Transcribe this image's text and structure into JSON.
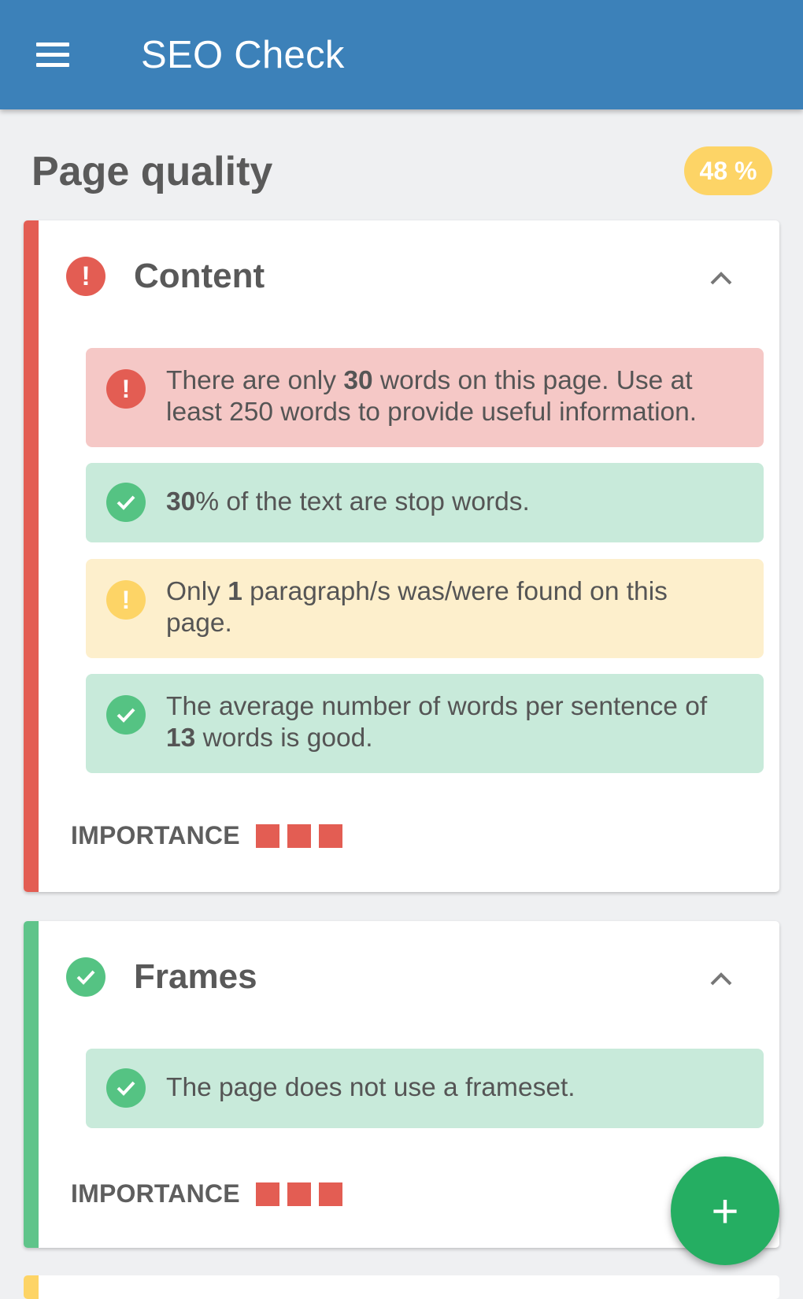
{
  "appbar": {
    "title": "SEO Check",
    "menu_icon": "hamburger-menu-icon"
  },
  "header": {
    "title": "Page quality",
    "score": "48 %"
  },
  "colors": {
    "error": "#e35d53",
    "success": "#55c383",
    "warning": "#fdd466",
    "primary": "#3c81b9",
    "fab": "#25ae62"
  },
  "cards": [
    {
      "title": "Content",
      "status": "error",
      "items": [
        {
          "status": "error",
          "pre": "There are only ",
          "bold": "30",
          "post": " words on this page. Use at least 250 words to provide useful information."
        },
        {
          "status": "success",
          "pre": "",
          "bold": "30",
          "post": "% of the text are stop words."
        },
        {
          "status": "warning",
          "pre": "Only ",
          "bold": "1",
          "post": " paragraph/s was/were found on this page."
        },
        {
          "status": "success",
          "pre": "The average number of words per sentence of ",
          "bold": "13",
          "post": " words is good."
        }
      ],
      "importance_label": "IMPORTANCE",
      "importance_level": 3
    },
    {
      "title": "Frames",
      "status": "success",
      "items": [
        {
          "status": "success",
          "text": "The page does not use a frameset."
        }
      ],
      "importance_label": "IMPORTANCE",
      "importance_level": 3
    }
  ],
  "fab": {
    "icon": "plus-icon",
    "label": "+"
  }
}
